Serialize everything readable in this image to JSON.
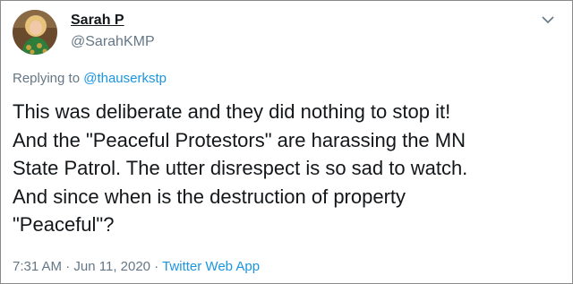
{
  "user": {
    "display_name": "Sarah P",
    "handle": "@SarahKMP"
  },
  "reply": {
    "prefix": "Replying to ",
    "mention": "@thauserkstp"
  },
  "tweet": {
    "text": "This was deliberate and they did nothing to stop it!\nAnd the \"Peaceful Protestors\" are harassing the MN\nState Patrol.  The utter disrespect is so sad to watch.\nAnd since when is the destruction of property\n\"Peaceful\"?"
  },
  "meta": {
    "time": "7:31 AM",
    "separator1": " · ",
    "date": "Jun 11, 2020",
    "separator2": " · ",
    "source": "Twitter Web App"
  },
  "icons": {
    "menu": "chevron-down-icon"
  },
  "colors": {
    "link": "#1b95e0",
    "secondary_text": "#657786",
    "primary_text": "#14171a"
  }
}
